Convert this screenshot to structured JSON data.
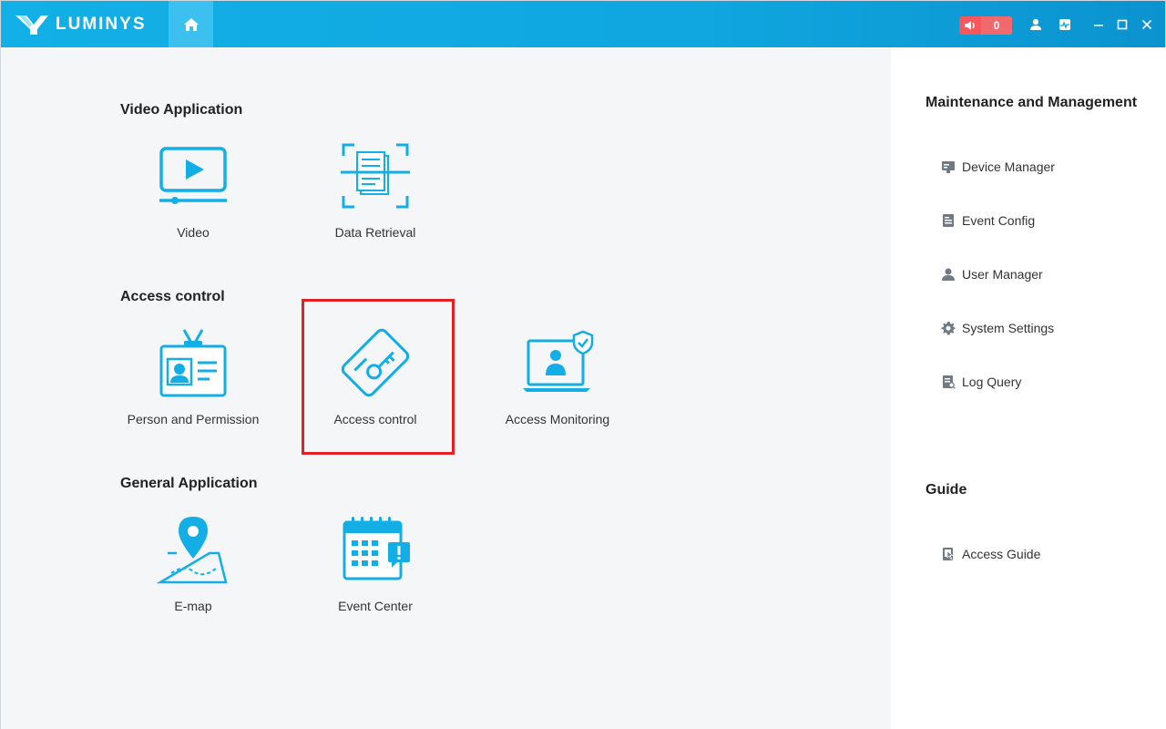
{
  "brand": {
    "name": "LUMINYS"
  },
  "colors": {
    "accent": "#13aee5",
    "highlight": "#e32026",
    "alarm": "#f4585c"
  },
  "titlebar": {
    "alarm_count": "0",
    "icons": [
      "home-icon",
      "speaker-icon",
      "user-icon",
      "activity-icon",
      "minimize-icon",
      "maximize-icon",
      "close-icon"
    ]
  },
  "sections": {
    "video": {
      "title": "Video Application",
      "apps": [
        {
          "label": "Video",
          "icon": "video-icon"
        },
        {
          "label": "Data Retrieval",
          "icon": "data-retrieval-icon"
        }
      ]
    },
    "access": {
      "title": "Access control",
      "apps": [
        {
          "label": "Person and Permission",
          "icon": "id-badge-icon"
        },
        {
          "label": "Access control",
          "icon": "key-card-icon"
        },
        {
          "label": "Access Monitoring",
          "icon": "monitor-shield-icon"
        }
      ]
    },
    "general": {
      "title": "General Application",
      "apps": [
        {
          "label": "E-map",
          "icon": "map-pin-icon"
        },
        {
          "label": "Event Center",
          "icon": "calendar-alert-icon"
        }
      ]
    }
  },
  "right_panel": {
    "maintenance": {
      "title": "Maintenance and Management",
      "items": [
        {
          "label": "Device Manager",
          "icon": "device-icon"
        },
        {
          "label": "Event Config",
          "icon": "event-config-icon"
        },
        {
          "label": "User Manager",
          "icon": "user-icon"
        },
        {
          "label": "System Settings",
          "icon": "gear-icon"
        },
        {
          "label": "Log Query",
          "icon": "log-icon"
        }
      ]
    },
    "guide": {
      "title": "Guide",
      "items": [
        {
          "label": "Access Guide",
          "icon": "guide-icon"
        }
      ]
    }
  }
}
